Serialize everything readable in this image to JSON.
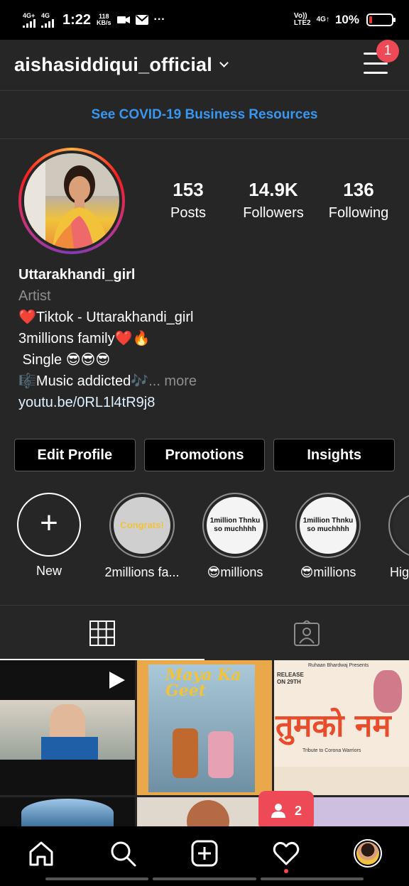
{
  "status_bar": {
    "sim1_type": "4G+",
    "sim2_type": "4G",
    "time": "1:22",
    "speed_value": "118",
    "speed_unit": "KB/s",
    "overflow": "···",
    "volte": "Vo))",
    "lte": "LTE2",
    "net_right": "4G↑",
    "battery": "10%",
    "battery_color": "#e53935"
  },
  "header": {
    "username": "aishasiddiqui_official",
    "menu_badge": "1"
  },
  "banner": {
    "covid_link": "See COVID-19 Business Resources",
    "link_color": "#3897f0"
  },
  "profile": {
    "stats": [
      {
        "value": "153",
        "label": "Posts"
      },
      {
        "value": "14.9K",
        "label": "Followers"
      },
      {
        "value": "136",
        "label": "Following"
      }
    ],
    "name": "Uttarakhandi_girl",
    "category": "Artist",
    "bio_lines": [
      "❤️Tiktok - Uttarakhandi_girl",
      "3millions family❤️🔥",
      " Single 😎😎😎",
      "🎼Music addicted🎶"
    ],
    "more": "... more",
    "link": "youtu.be/0RL1l4tR9j8"
  },
  "buttons": {
    "edit_profile": "Edit Profile",
    "promotions": "Promotions",
    "insights": "Insights"
  },
  "highlights": [
    {
      "label": "New",
      "thumb": ""
    },
    {
      "label": "2millions fa...",
      "thumb": "Congrats!"
    },
    {
      "label": "😎millions",
      "thumb": "1million Thnku so muchhhh"
    },
    {
      "label": "😎millions",
      "thumb": "1million Thnku so muchhhh"
    },
    {
      "label": "Hig",
      "thumb": ""
    }
  ],
  "grid": {
    "poster2_title": "Maya Ka Geet",
    "poster3_title": "तुमको नम",
    "poster3_release": "RELEASE ON 29TH",
    "poster3_credit": "Ruhaan Bhardwaj Presents",
    "poster3_tagline": "Tribute to Corona Warriors"
  },
  "notification": {
    "count": "2"
  },
  "nav": {
    "icons": [
      "home-icon",
      "search-icon",
      "add-post-icon",
      "activity-heart-icon",
      "profile-avatar"
    ]
  },
  "colors": {
    "background": "#262626",
    "badge": "#ed4956"
  }
}
